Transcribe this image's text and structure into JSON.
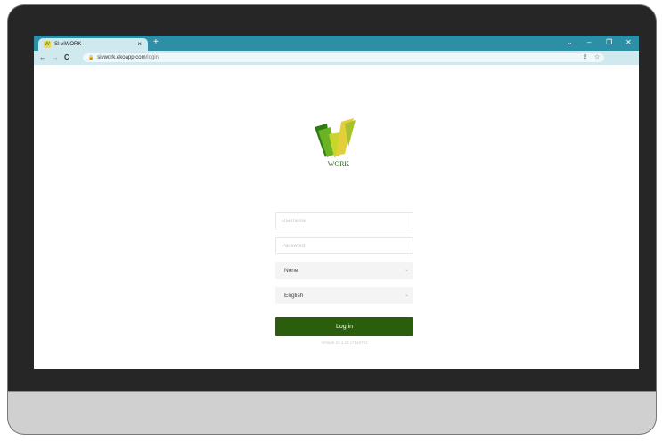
{
  "browser": {
    "tab_title": "SI viWORK",
    "tab_close": "×",
    "new_tab": "+",
    "url_domain": "sivwork.ekoapp.com",
    "url_path": "/login",
    "window_controls": {
      "dropdown": "⌄",
      "minimize": "–",
      "restore": "❐",
      "close": "✕"
    },
    "nav": {
      "back": "←",
      "forward": "→",
      "reload": "C"
    },
    "icons": [
      "share-icon",
      "star-icon"
    ]
  },
  "login": {
    "logo_text": "WORK",
    "username_placeholder": "Username",
    "password_placeholder": "Password",
    "company_select": "None",
    "language_select": "English",
    "login_button": "Log in",
    "version": "Version 15.1.10 c71a4751"
  },
  "colors": {
    "tabbar": "#2c8fa5",
    "toolbar": "#cfe9ee",
    "login_button": "#2a5e0d",
    "logo_green": "#2d5d1a",
    "logo_yellow": "#f1d54a"
  }
}
